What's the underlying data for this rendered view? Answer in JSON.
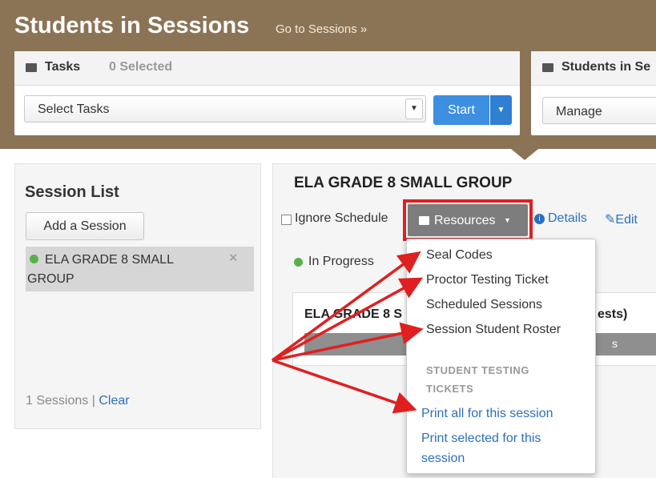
{
  "header": {
    "title": "Students in Sessions",
    "goto_link": "Go to Sessions »"
  },
  "tasks": {
    "title": "Tasks",
    "selected": "0 Selected",
    "select_value": "Select Tasks",
    "start_label": "Start"
  },
  "students_panel": {
    "title": "Students in Se",
    "select_value": "Manage"
  },
  "session_list": {
    "title": "Session List",
    "add_button": "Add a Session",
    "items": [
      {
        "name": "ELA GRADE 8 SMALL GROUP",
        "status_color": "#58b04a"
      }
    ],
    "count_text": "1 Sessions |",
    "clear_link": "Clear"
  },
  "session": {
    "title": "ELA GRADE 8 SMALL GROUP",
    "ignore_label": "Ignore Schedule",
    "resources_label": "Resources",
    "details_label": "Details",
    "edit_label": "Edit",
    "status": "In Progress",
    "test_title": "ELA GRADE 8 S",
    "test_suffix": "ests)",
    "bar_fragment": "s"
  },
  "resources_menu": {
    "items": [
      "Seal Codes",
      "Proctor Testing Ticket",
      "Scheduled Sessions",
      "Session Student Roster"
    ],
    "section_header": "STUDENT TESTING TICKETS",
    "links": [
      "Print all for this session",
      "Print selected for this session"
    ]
  },
  "colors": {
    "header_bg": "#8b7455",
    "accent_blue": "#3d8fe0",
    "link": "#2a6fbf",
    "highlight_red": "#e02020",
    "status_green": "#58b04a"
  }
}
